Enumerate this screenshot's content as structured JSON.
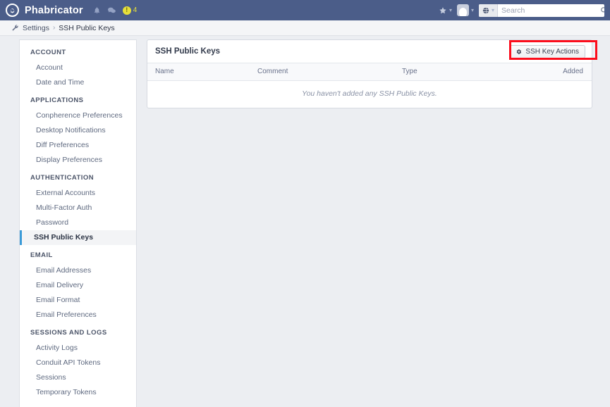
{
  "topnav": {
    "logo_icon": "gear-eye-logo-icon",
    "brand": "Phabricator",
    "icons": [
      {
        "name": "bell-icon"
      },
      {
        "name": "chat-bubble-icon"
      }
    ],
    "alert_badge": {
      "symbol": "!",
      "count": "4",
      "color": "#e7e03a"
    },
    "favorites": {
      "icon": "star-icon",
      "caret": "▾"
    },
    "profile": {
      "icon": "user-avatar-icon",
      "caret": "▾"
    },
    "search": {
      "scope_icon": "globe-icon",
      "scope_caret": "▾",
      "placeholder": "Search",
      "value": "",
      "submit_icon": "magnifier-icon"
    }
  },
  "breadcrumb": {
    "icon": "wrench-icon",
    "root": "Settings",
    "separator": "›",
    "current": "SSH Public Keys"
  },
  "sidebar": {
    "groups": [
      {
        "heading": "ACCOUNT",
        "items": [
          {
            "label": "Account",
            "active": false
          },
          {
            "label": "Date and Time",
            "active": false
          }
        ]
      },
      {
        "heading": "APPLICATIONS",
        "items": [
          {
            "label": "Conpherence Preferences",
            "active": false
          },
          {
            "label": "Desktop Notifications",
            "active": false
          },
          {
            "label": "Diff Preferences",
            "active": false
          },
          {
            "label": "Display Preferences",
            "active": false
          }
        ]
      },
      {
        "heading": "AUTHENTICATION",
        "items": [
          {
            "label": "External Accounts",
            "active": false
          },
          {
            "label": "Multi-Factor Auth",
            "active": false
          },
          {
            "label": "Password",
            "active": false
          },
          {
            "label": "SSH Public Keys",
            "active": true
          }
        ]
      },
      {
        "heading": "EMAIL",
        "items": [
          {
            "label": "Email Addresses",
            "active": false
          },
          {
            "label": "Email Delivery",
            "active": false
          },
          {
            "label": "Email Format",
            "active": false
          },
          {
            "label": "Email Preferences",
            "active": false
          }
        ]
      },
      {
        "heading": "SESSIONS AND LOGS",
        "items": [
          {
            "label": "Activity Logs",
            "active": false
          },
          {
            "label": "Conduit API Tokens",
            "active": false
          },
          {
            "label": "Sessions",
            "active": false
          },
          {
            "label": "Temporary Tokens",
            "active": false
          }
        ]
      }
    ]
  },
  "main": {
    "panel_title": "SSH Public Keys",
    "actions_button": {
      "label": "SSH Key Actions",
      "icon": "gear-icon"
    },
    "table": {
      "columns": [
        "Name",
        "Comment",
        "Type",
        "Added"
      ],
      "rows": [],
      "empty_message": "You haven't added any SSH Public Keys."
    }
  },
  "annotation": {
    "color": "#fc0d1c",
    "target": "ssh-key-actions-button"
  }
}
